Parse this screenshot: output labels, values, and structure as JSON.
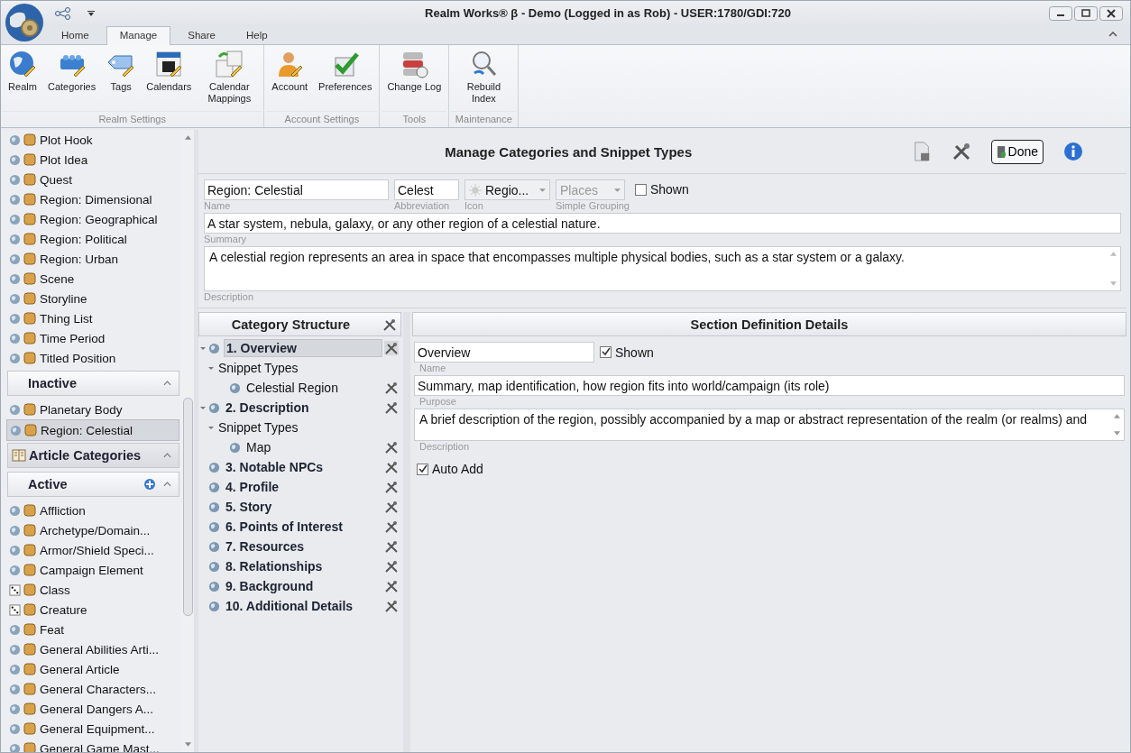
{
  "window": {
    "title": "Realm Works® β - Demo (Logged in as Rob) - USER:1780/GDI:720"
  },
  "ribbon_tabs": [
    {
      "label": "Home",
      "selected": false
    },
    {
      "label": "Manage",
      "selected": true
    },
    {
      "label": "Share",
      "selected": false
    },
    {
      "label": "Help",
      "selected": false
    }
  ],
  "ribbon_groups": [
    {
      "label": "Realm Settings",
      "buttons": [
        {
          "label": "Realm",
          "kind": "globe"
        },
        {
          "label": "Categories",
          "kind": "blocks"
        },
        {
          "label": "Tags",
          "kind": "tag"
        },
        {
          "label": "Calendars",
          "kind": "calendar"
        },
        {
          "label": "Calendar Mappings",
          "kind": "calendar-map"
        }
      ]
    },
    {
      "label": "Account Settings",
      "buttons": [
        {
          "label": "Account",
          "kind": "person"
        },
        {
          "label": "Preferences",
          "kind": "check"
        }
      ]
    },
    {
      "label": "Tools",
      "buttons": [
        {
          "label": "Change Log",
          "kind": "database"
        }
      ]
    },
    {
      "label": "Maintenance",
      "buttons": [
        {
          "label": "Rebuild Index",
          "kind": "search"
        }
      ]
    }
  ],
  "sidebar": {
    "top_items": [
      {
        "label": "Plot Hook",
        "kind": "globe",
        "selected": false
      },
      {
        "label": "Plot Idea",
        "kind": "globe",
        "selected": false
      },
      {
        "label": "Quest",
        "kind": "globe",
        "selected": false
      },
      {
        "label": "Region: Dimensional",
        "kind": "globe",
        "selected": false
      },
      {
        "label": "Region: Geographical",
        "kind": "globe",
        "selected": false
      },
      {
        "label": "Region: Political",
        "kind": "globe",
        "selected": false
      },
      {
        "label": "Region: Urban",
        "kind": "globe",
        "selected": false
      },
      {
        "label": "Scene",
        "kind": "globe",
        "selected": false
      },
      {
        "label": "Storyline",
        "kind": "globe",
        "selected": false
      },
      {
        "label": "Thing List",
        "kind": "globe",
        "selected": false
      },
      {
        "label": "Time Period",
        "kind": "globe",
        "selected": false
      },
      {
        "label": "Titled Position",
        "kind": "globe",
        "selected": false
      }
    ],
    "inactive": {
      "header": "Inactive",
      "expanded": true,
      "items": [
        {
          "label": "Planetary Body",
          "kind": "globe",
          "selected": false
        },
        {
          "label": "Region: Celestial",
          "kind": "globe",
          "selected": true
        }
      ]
    },
    "article_categories": {
      "header": "Article Categories",
      "expanded": true
    },
    "active": {
      "header": "Active",
      "expanded": true,
      "items": [
        {
          "label": "Affliction",
          "kind": "globe",
          "selected": false
        },
        {
          "label": "Archetype/Domain...",
          "kind": "globe",
          "selected": false
        },
        {
          "label": "Armor/Shield Speci...",
          "kind": "globe",
          "selected": false
        },
        {
          "label": "Campaign Element",
          "kind": "globe",
          "selected": false
        },
        {
          "label": "Class",
          "kind": "dice",
          "selected": false
        },
        {
          "label": "Creature",
          "kind": "dice",
          "selected": false
        },
        {
          "label": "Feat",
          "kind": "globe",
          "selected": false
        },
        {
          "label": "General Abilities Arti...",
          "kind": "globe",
          "selected": false
        },
        {
          "label": "General Article",
          "kind": "globe",
          "selected": false
        },
        {
          "label": "General Characters...",
          "kind": "globe",
          "selected": false
        },
        {
          "label": "General Dangers A...",
          "kind": "globe",
          "selected": false
        },
        {
          "label": "General Equipment...",
          "kind": "globe",
          "selected": false
        },
        {
          "label": "General Game Mast...",
          "kind": "globe",
          "selected": false
        }
      ]
    }
  },
  "manage": {
    "title": "Manage Categories and Snippet Types",
    "done_button": "Done",
    "name": {
      "value": "Region: Celestial",
      "label": "Name"
    },
    "abbreviation": {
      "value": "Celest",
      "label": "Abbreviation"
    },
    "icon": {
      "value": "Regio...",
      "label": "Icon"
    },
    "simple_grouping": {
      "value": "Places",
      "label": "Simple Grouping",
      "disabled": true
    },
    "shown": {
      "label": "Shown",
      "checked": false
    },
    "summary": {
      "value": "A star system, nebula, galaxy, or any other region of a celestial nature.",
      "label": "Summary"
    },
    "description": {
      "value": "A celestial region represents an area in space that encompasses multiple physical bodies, such as a star system or a galaxy.",
      "label": "Description"
    }
  },
  "category_structure": {
    "header": "Category Structure",
    "nodes": [
      {
        "kind": "section",
        "label": "1. Overview",
        "selected": true,
        "expanded": true,
        "children": [
          {
            "label": "Snippet Types",
            "selected": false,
            "expanded": true,
            "children": [
              {
                "label": "Celestial Region",
                "selected": false
              }
            ]
          }
        ]
      },
      {
        "kind": "section",
        "label": "2. Description",
        "selected": false,
        "expanded": true,
        "children": [
          {
            "label": "Snippet Types",
            "selected": false,
            "expanded": true,
            "children": [
              {
                "label": "Map",
                "selected": false
              }
            ]
          }
        ]
      },
      {
        "kind": "section",
        "label": "3. Notable NPCs",
        "selected": false
      },
      {
        "kind": "section",
        "label": "4. Profile",
        "selected": false
      },
      {
        "kind": "section",
        "label": "5. Story",
        "selected": false
      },
      {
        "kind": "section",
        "label": "6. Points of Interest",
        "selected": false
      },
      {
        "kind": "section",
        "label": "7. Resources",
        "selected": false
      },
      {
        "kind": "section",
        "label": "8. Relationships",
        "selected": false
      },
      {
        "kind": "section",
        "label": "9. Background",
        "selected": false
      },
      {
        "kind": "section",
        "label": "10. Additional Details",
        "selected": false
      }
    ]
  },
  "section_details": {
    "header": "Section Definition Details",
    "name": {
      "value": "Overview",
      "label": "Name"
    },
    "shown": {
      "label": "Shown",
      "checked": true
    },
    "purpose": {
      "value": "Summary, map identification, how region fits into world/campaign (its role)",
      "label": "Purpose"
    },
    "description": {
      "value": "A brief description of the region, possibly accompanied by a map or abstract representation of the realm (or realms) and",
      "label": "Description"
    },
    "auto_add": {
      "label": "Auto Add",
      "checked": true
    }
  }
}
